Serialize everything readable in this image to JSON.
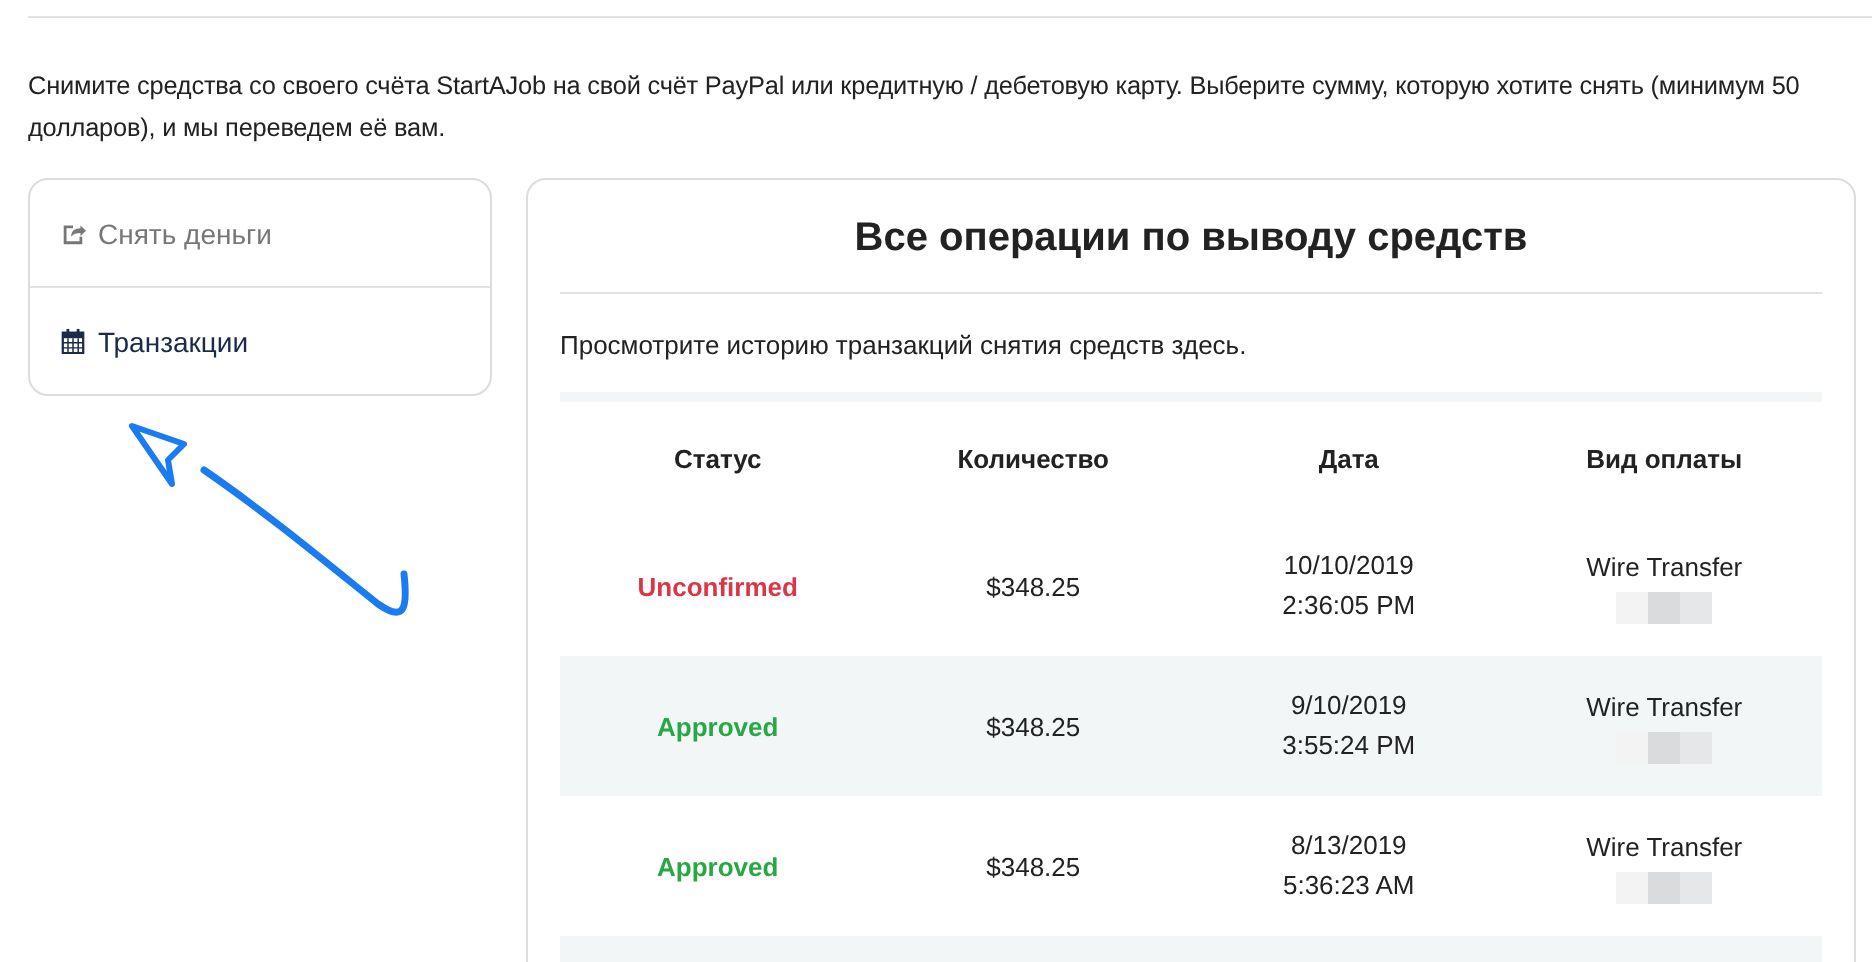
{
  "intro": "Снимите средства со своего счёта StartAJob на свой счёт PayPal или кредитную / дебетовую карту. Выберите сумму, которую хотите снять (минимум 50 долларов), и мы переведем её вам.",
  "sidebar": {
    "items": [
      {
        "label": "Снять деньги",
        "selected": false
      },
      {
        "label": "Транзакции",
        "selected": true
      }
    ]
  },
  "panel": {
    "title": "Все операции по выводу средств",
    "subtitle": "Просмотрите историю транзакций снятия средств здесь.",
    "table": {
      "columns": [
        "Статус",
        "Количество",
        "Дата",
        "Вид оплаты"
      ],
      "rows": [
        {
          "status": "Unconfirmed",
          "kind": "unconfirmed",
          "amount": "$348.25",
          "date": "10/10/2019",
          "time": "2:36:05 PM",
          "method": "Wire Transfer"
        },
        {
          "status": "Approved",
          "kind": "approved",
          "amount": "$348.25",
          "date": "9/10/2019",
          "time": "3:55:24 PM",
          "method": "Wire Transfer"
        },
        {
          "status": "Approved",
          "kind": "approved",
          "amount": "$348.25",
          "date": "8/13/2019",
          "time": "5:36:23 AM",
          "method": "Wire Transfer"
        }
      ]
    }
  }
}
